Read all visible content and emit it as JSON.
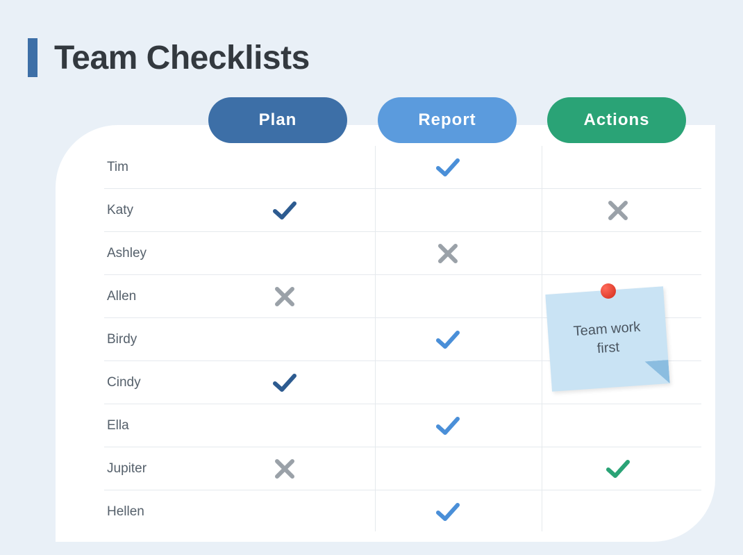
{
  "title": "Team Checklists",
  "columns": {
    "plan": "Plan",
    "report": "Report",
    "actions": "Actions"
  },
  "note": {
    "text": "Team work first"
  },
  "rows": [
    {
      "name": "Tim",
      "plan": "",
      "report": "check-light",
      "actions": ""
    },
    {
      "name": "Katy",
      "plan": "check-dark",
      "report": "",
      "actions": "cross"
    },
    {
      "name": "Ashley",
      "plan": "",
      "report": "cross",
      "actions": ""
    },
    {
      "name": "Allen",
      "plan": "cross",
      "report": "",
      "actions": ""
    },
    {
      "name": "Birdy",
      "plan": "",
      "report": "check-light",
      "actions": ""
    },
    {
      "name": "Cindy",
      "plan": "check-dark",
      "report": "",
      "actions": ""
    },
    {
      "name": "Ella",
      "plan": "",
      "report": "check-light",
      "actions": ""
    },
    {
      "name": "Jupiter",
      "plan": "cross",
      "report": "",
      "actions": "check-green"
    },
    {
      "name": "Hellen",
      "plan": "",
      "report": "check-light",
      "actions": ""
    }
  ],
  "icon_colors": {
    "check-dark": "#2d5b90",
    "check-light": "#4a8fd8",
    "check-green": "#2aa376",
    "cross": "#9aa1a8"
  }
}
